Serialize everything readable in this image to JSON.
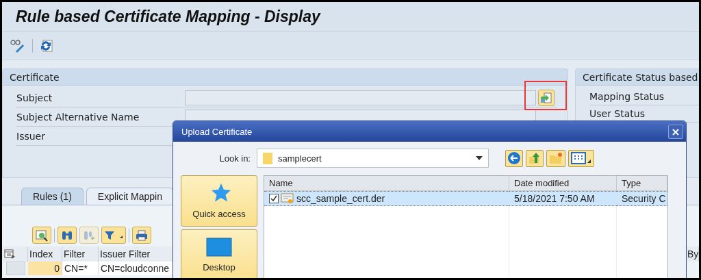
{
  "title": "Rule based Certificate Mapping - Display",
  "certificate_panel": {
    "title": "Certificate",
    "fields": [
      "Subject",
      "Subject Alternative Name",
      "Issuer"
    ]
  },
  "status_panel": {
    "title": "Certificate Status based",
    "fields": [
      "Mapping Status",
      "User Status"
    ]
  },
  "tabs": [
    {
      "label": "Rules (1)",
      "selected": true
    },
    {
      "label": "Explicit Mappin",
      "selected": false
    }
  ],
  "table": {
    "columns": [
      "Index",
      "Filter",
      "Issuer Filter",
      "By"
    ],
    "rows": [
      [
        "0",
        "CN=*",
        "CN=cloudconne"
      ]
    ]
  },
  "dialog": {
    "title": "Upload Certificate",
    "look_in_label": "Look in:",
    "folder": "samplecert",
    "places": [
      {
        "label": "Quick access",
        "kind": "star"
      },
      {
        "label": "Desktop",
        "kind": "desktop"
      }
    ],
    "columns": [
      "Name",
      "Date modified",
      "Type"
    ],
    "files": [
      {
        "name": "scc_sample_cert.der",
        "date": "5/18/2021 7:50 AM",
        "type": "Security C",
        "selected": true,
        "checked": true
      }
    ]
  }
}
